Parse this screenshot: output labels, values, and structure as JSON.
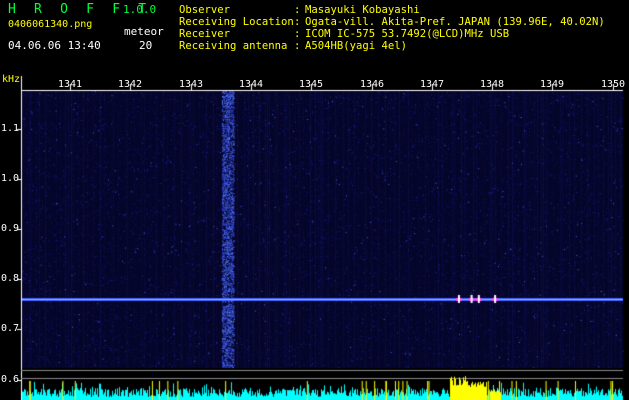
{
  "header": {
    "app_title": "H R O F F T",
    "version": "1.0.0",
    "filename": "0406061340.png",
    "datetime": "04.06.06 13:40",
    "meteor_label": "meteor",
    "meteor_count": "20"
  },
  "station_info": [
    {
      "label": "Observer",
      "value": "Masayuki Kobayashi"
    },
    {
      "label": "Receiving Location",
      "value": "Ogata-vill. Akita-Pref. JAPAN (139.96E, 40.02N)"
    },
    {
      "label": "Receiver",
      "value": "ICOM IC-575 53.7492(@LCD)MHz USB"
    },
    {
      "label": "Receiving antenna",
      "value": "A504HB(yagi 4el)"
    }
  ],
  "colors": {
    "text_green": "#00ff3c",
    "text_yellow": "#ffff00",
    "axis": "#ffffff",
    "background": "#000000",
    "noise_bar": "#00ffff",
    "meteor_echo": "#ffff00"
  },
  "chart_data": {
    "type": "heatmap",
    "y_unit": "kHz",
    "x_ticks": [
      "1341",
      "1342",
      "1343",
      "1344",
      "1345",
      "1346",
      "1347",
      "1348",
      "1349",
      "1350"
    ],
    "y_ticks": [
      "1.1",
      "1.0",
      "0.9",
      "0.8",
      "0.7",
      "0.6"
    ],
    "x_range": [
      1340.7,
      1350.1
    ],
    "y_range": [
      0.585,
      1.185
    ],
    "carrier_khz": 0.761,
    "strong_column_minute": 1343.6,
    "meteor_echoes": [
      {
        "minute": 1347.45,
        "strength": 1.0
      },
      {
        "minute": 1347.66,
        "strength": 0.55
      },
      {
        "minute": 1347.78,
        "strength": 0.8
      },
      {
        "minute": 1348.05,
        "strength": 0.35
      }
    ]
  }
}
